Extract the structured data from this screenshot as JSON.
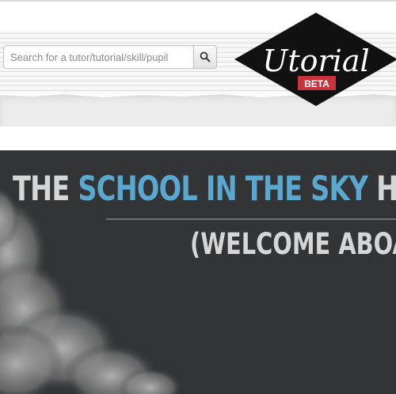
{
  "header": {
    "search": {
      "placeholder": "Search for a tutor/tutorial/skill/pupil",
      "button_icon": "search-icon"
    },
    "logo": {
      "wordmark": "Utorial",
      "badge": "BETA",
      "colors": {
        "diamond": "#111111",
        "badge": "#c8343b"
      }
    }
  },
  "hero": {
    "title_parts": [
      "THE ",
      "SCHOOL IN THE SKY",
      " HA"
    ],
    "subtitle": "(WELCOME ABOAR",
    "colors": {
      "accent": "#5aa8cf",
      "text": "#d6d6d6",
      "background": "#333436"
    }
  }
}
